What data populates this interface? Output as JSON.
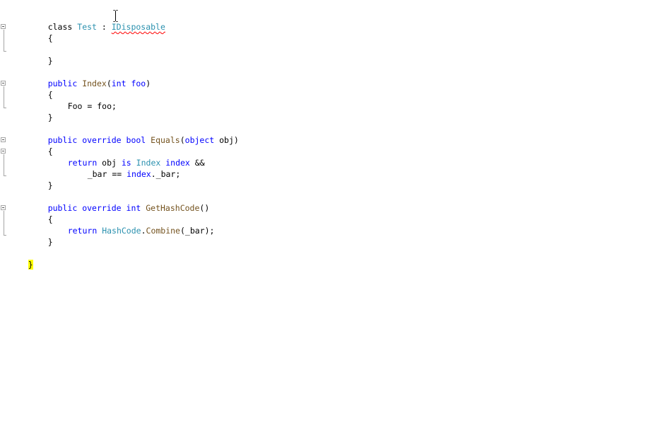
{
  "code": {
    "class_kw": "class",
    "class_name": "Test",
    "colon": " : ",
    "interface": "IDisposable",
    "open_brace": "{",
    "close_brace": "}",
    "public": "public",
    "override": "override",
    "ctor_name": "Index",
    "paren_open": "(",
    "paren_close": ")",
    "int": "int",
    "bool": "bool",
    "object": "object",
    "param_foo": " foo",
    "param_obj": " obj",
    "assign_line": "Foo = foo;",
    "equals_name": "Equals",
    "return_kw": "return",
    "obj_text": " obj ",
    "is_kw": "is",
    "index_type": "Index",
    "index_var": "index",
    "and_op": " &&",
    "bar_cmp": "_bar == ",
    "index_ref": "index",
    "bar_tail": "._bar;",
    "gethash_name": "GetHashCode",
    "empty_parens": "()",
    "hashcode_type": "HashCode",
    "dot": ".",
    "combine_name": "Combine",
    "combine_args": "(_bar);",
    "final_brace": "}"
  }
}
